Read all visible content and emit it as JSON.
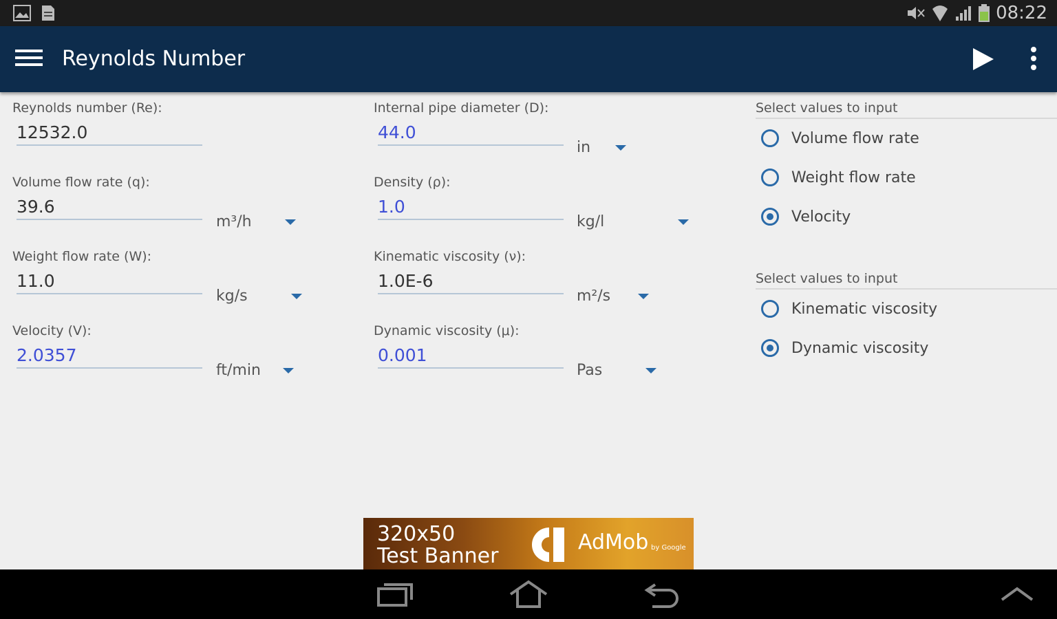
{
  "status_bar": {
    "time": "08:22",
    "icons": [
      "gallery-icon",
      "document-icon",
      "mute-icon",
      "wifi-icon",
      "signal-icon",
      "battery-icon"
    ]
  },
  "app_bar": {
    "title": "Reynolds Number",
    "icons": [
      "menu-icon",
      "play-icon",
      "overflow-icon"
    ],
    "background": "#0d2c4c"
  },
  "fields": {
    "reynolds": {
      "label": "Reynolds number (Re):",
      "value": "12532.0"
    },
    "volume_flow": {
      "label": "Volume flow rate (q):",
      "value": "39.6",
      "unit": "m³/h"
    },
    "weight_flow": {
      "label": "Weight flow rate (W):",
      "value": "11.0",
      "unit": "kg/s"
    },
    "velocity": {
      "label": "Velocity (V):",
      "value": "2.0357",
      "unit": "ft/min"
    },
    "diameter": {
      "label": "Internal pipe diameter (D):",
      "value": "44.0",
      "unit": "in"
    },
    "density": {
      "label": "Density (ρ):",
      "value": "1.0",
      "unit": "kg/l"
    },
    "kinematic": {
      "label": "Kinematic viscosity (ν):",
      "value": "1.0E-6",
      "unit": "m²/s"
    },
    "dynamic": {
      "label": "Dynamic viscosity (μ):",
      "value": "0.001",
      "unit": "Pas"
    }
  },
  "input_group_1": {
    "header": "Select values to input",
    "options": [
      {
        "label": "Volume flow rate",
        "checked": false
      },
      {
        "label": "Weight flow rate",
        "checked": false
      },
      {
        "label": "Velocity",
        "checked": true
      }
    ]
  },
  "input_group_2": {
    "header": "Select values to input",
    "options": [
      {
        "label": "Kinematic viscosity",
        "checked": false
      },
      {
        "label": "Dynamic viscosity",
        "checked": true
      }
    ]
  },
  "ad": {
    "size_text": "320x50",
    "test_text": "Test Banner",
    "brand": "AdMob",
    "by": "by Google"
  },
  "nav_bar": {
    "icons": [
      "recent-apps-icon",
      "home-icon",
      "back-icon",
      "chevron-up-icon"
    ]
  },
  "colors": {
    "accent": "#2a6aa8",
    "input_value_blue": "#3f4fd6"
  }
}
